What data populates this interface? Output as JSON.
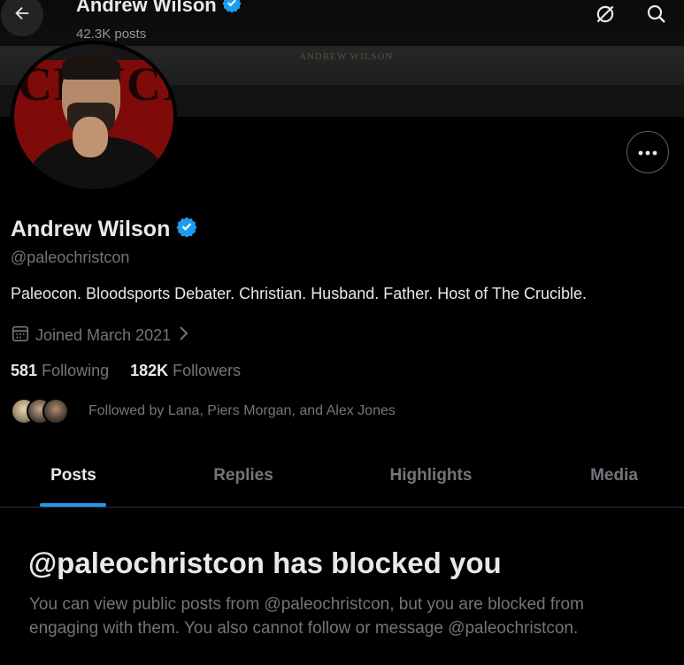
{
  "banner": {
    "text": "ANDREW WILSON"
  },
  "header": {
    "name": "Andrew Wilson",
    "posts_count": "42.3K posts"
  },
  "profile": {
    "name": "Andrew Wilson",
    "handle": "@paleochristcon",
    "bio": "Paleocon. Bloodsports Debater. Christian. Husband. Father. Host of The Crucible.",
    "joined": "Joined March 2021",
    "following_count": "581",
    "following_label": "Following",
    "followers_count": "182K",
    "followers_label": "Followers",
    "followed_by": "Followed by Lana, Piers Morgan, and Alex Jones",
    "avatar_text": "CRUCIB"
  },
  "tabs": [
    {
      "label": "Posts",
      "active": true
    },
    {
      "label": "Replies",
      "active": false
    },
    {
      "label": "Highlights",
      "active": false
    },
    {
      "label": "Media",
      "active": false
    }
  ],
  "blocked": {
    "title": "@paleochristcon has blocked you",
    "message": "You can view public posts from @paleochristcon, but you are blocked from engaging with them. You also cannot follow or message @paleochristcon."
  },
  "icons": {
    "back": "back-arrow-icon",
    "grok": "grok-icon",
    "search": "search-icon",
    "more": "more-icon",
    "verified": "verified-badge-icon",
    "calendar": "calendar-icon",
    "chevron": "chevron-right-icon"
  },
  "colors": {
    "accent": "#1d9bf0",
    "background": "#000000",
    "text_primary": "#e7e9ea",
    "text_secondary": "#71767b"
  }
}
